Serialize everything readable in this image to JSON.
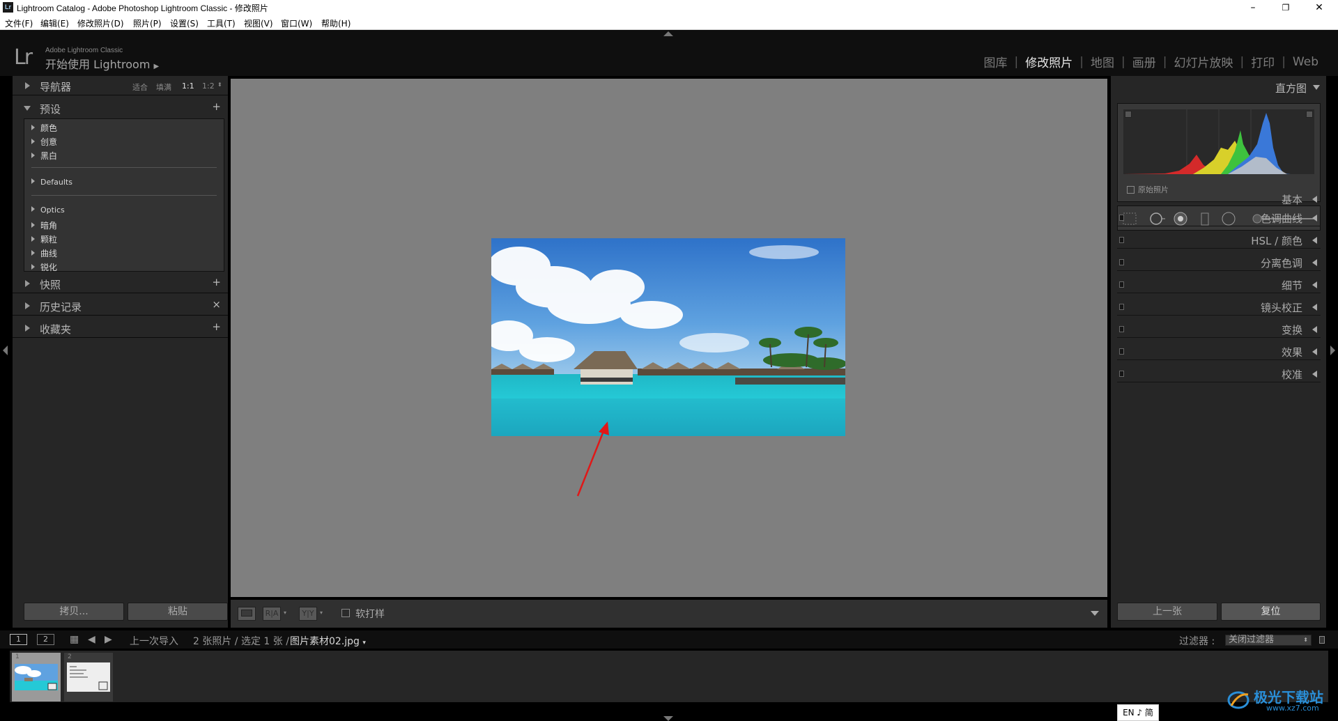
{
  "window": {
    "title": "Lightroom Catalog - Adobe Photoshop Lightroom Classic - 修改照片",
    "app_icon": "Lr",
    "minimize": "–",
    "maximize": "❐",
    "close": "✕"
  },
  "menubar": [
    "文件(F)",
    "编辑(E)",
    "修改照片(D)",
    "照片(P)",
    "设置(S)",
    "工具(T)",
    "视图(V)",
    "窗口(W)",
    "帮助(H)"
  ],
  "header": {
    "logo": "Lr",
    "brand": "Adobe Lightroom Classic",
    "identity_plate": "开始使用 Lightroom",
    "modules": [
      "图库",
      "修改照片",
      "地图",
      "画册",
      "幻灯片放映",
      "打印",
      "Web"
    ],
    "active_module": "修改照片"
  },
  "left_panel": {
    "navigator": {
      "label": "导航器",
      "zoom_options": [
        "适合",
        "填满",
        "1:1",
        "1:2"
      ],
      "active_zoom": "1:1"
    },
    "presets": {
      "label": "预设",
      "add": "+",
      "groups": [
        [
          "颜色",
          "创意",
          "黑白"
        ],
        [
          "Defaults"
        ],
        [
          "Optics",
          "暗角",
          "颗粒",
          "曲线",
          "锐化"
        ]
      ]
    },
    "snapshots": {
      "label": "快照",
      "action": "+"
    },
    "history": {
      "label": "历史记录",
      "action": "×"
    },
    "collections": {
      "label": "收藏夹",
      "action": "+"
    },
    "copy_button": "拷贝...",
    "paste_button": "粘贴"
  },
  "toolbar": {
    "view_loupe": "",
    "view_before_after": "R|A",
    "view_yy": "Y|Y",
    "soft_proofing": "软打样",
    "soft_proofing_checked": false
  },
  "right_panel": {
    "histogram_label": "直方图",
    "original_photo_label": "原始照片",
    "original_photo_checked": false,
    "basic_label": "基本",
    "sections": [
      "色调曲线",
      "HSL / 颜色",
      "分离色调",
      "细节",
      "镜头校正",
      "变换",
      "效果",
      "校准"
    ],
    "previous_button": "上一张",
    "reset_button": "复位"
  },
  "filmstrip_bar": {
    "page1": "1",
    "page2": "2",
    "source": "上一次导入",
    "count": "2 张照片 / 选定 1 张 /",
    "filename": "图片素材02.jpg",
    "filter_label": "过滤器 :",
    "filter_value": "关闭过滤器"
  },
  "filmstrip": {
    "thumbnails": [
      {
        "num": "1",
        "selected": true
      },
      {
        "num": "2",
        "selected": false
      }
    ]
  },
  "ime": "EN ♪ 简",
  "watermark": {
    "text": "极光下载站",
    "url": "www.xz7.com"
  },
  "colors": {
    "accent_arrow": "#e01818",
    "panel_bg": "#262626",
    "canvas_bg": "#7f7f7f",
    "active_module": "#e6e6e6"
  }
}
